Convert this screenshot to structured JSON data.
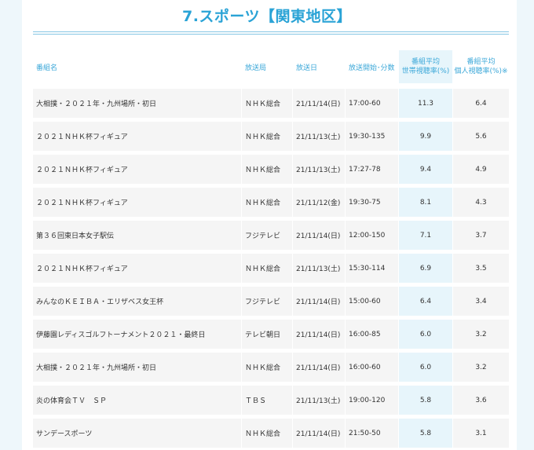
{
  "page": {
    "title": "7.スポーツ【関東地区】"
  },
  "table": {
    "headers": {
      "program": "番組名",
      "station": "放送局",
      "date": "放送日",
      "start": "放送開始･分数",
      "hh_line1": "番組平均",
      "hh_line2": "世帯視聴率(%)",
      "ind_line1": "番組平均",
      "ind_line2": "個人視聴率(%)※"
    },
    "rows": [
      {
        "program": "大相撲・２０２１年・九州場所・初日",
        "station": "ＮＨＫ総合",
        "date": "21/11/14(日)",
        "start": "17:00-60",
        "household": "11.3",
        "individual": "6.4"
      },
      {
        "program": "２０２１ＮＨＫ杯フィギュア",
        "station": "ＮＨＫ総合",
        "date": "21/11/13(土)",
        "start": "19:30-135",
        "household": "9.9",
        "individual": "5.6"
      },
      {
        "program": "２０２１ＮＨＫ杯フィギュア",
        "station": "ＮＨＫ総合",
        "date": "21/11/13(土)",
        "start": "17:27-78",
        "household": "9.4",
        "individual": "4.9"
      },
      {
        "program": "２０２１ＮＨＫ杯フィギュア",
        "station": "ＮＨＫ総合",
        "date": "21/11/12(金)",
        "start": "19:30-75",
        "household": "8.1",
        "individual": "4.3"
      },
      {
        "program": "第３６回東日本女子駅伝",
        "station": "フジテレビ",
        "date": "21/11/14(日)",
        "start": "12:00-150",
        "household": "7.1",
        "individual": "3.7"
      },
      {
        "program": "２０２１ＮＨＫ杯フィギュア",
        "station": "ＮＨＫ総合",
        "date": "21/11/13(土)",
        "start": "15:30-114",
        "household": "6.9",
        "individual": "3.5"
      },
      {
        "program": "みんなのＫＥＩＢＡ・エリザベス女王杯",
        "station": "フジテレビ",
        "date": "21/11/14(日)",
        "start": "15:00-60",
        "household": "6.4",
        "individual": "3.4"
      },
      {
        "program": "伊藤園レディスゴルフトーナメント２０２１・最終日",
        "station": "テレビ朝日",
        "date": "21/11/14(日)",
        "start": "16:00-85",
        "household": "6.0",
        "individual": "3.2"
      },
      {
        "program": "大相撲・２０２１年・九州場所・初日",
        "station": "ＮＨＫ総合",
        "date": "21/11/14(日)",
        "start": "16:00-60",
        "household": "6.0",
        "individual": "3.2"
      },
      {
        "program": "炎の体育会ＴＶ　ＳＰ",
        "station": "ＴＢＳ",
        "date": "21/11/13(土)",
        "start": "19:00-120",
        "household": "5.8",
        "individual": "3.6"
      },
      {
        "program": "サンデースポーツ",
        "station": "ＮＨＫ総合",
        "date": "21/11/14(日)",
        "start": "21:50-50",
        "household": "5.8",
        "individual": "3.1"
      }
    ]
  }
}
